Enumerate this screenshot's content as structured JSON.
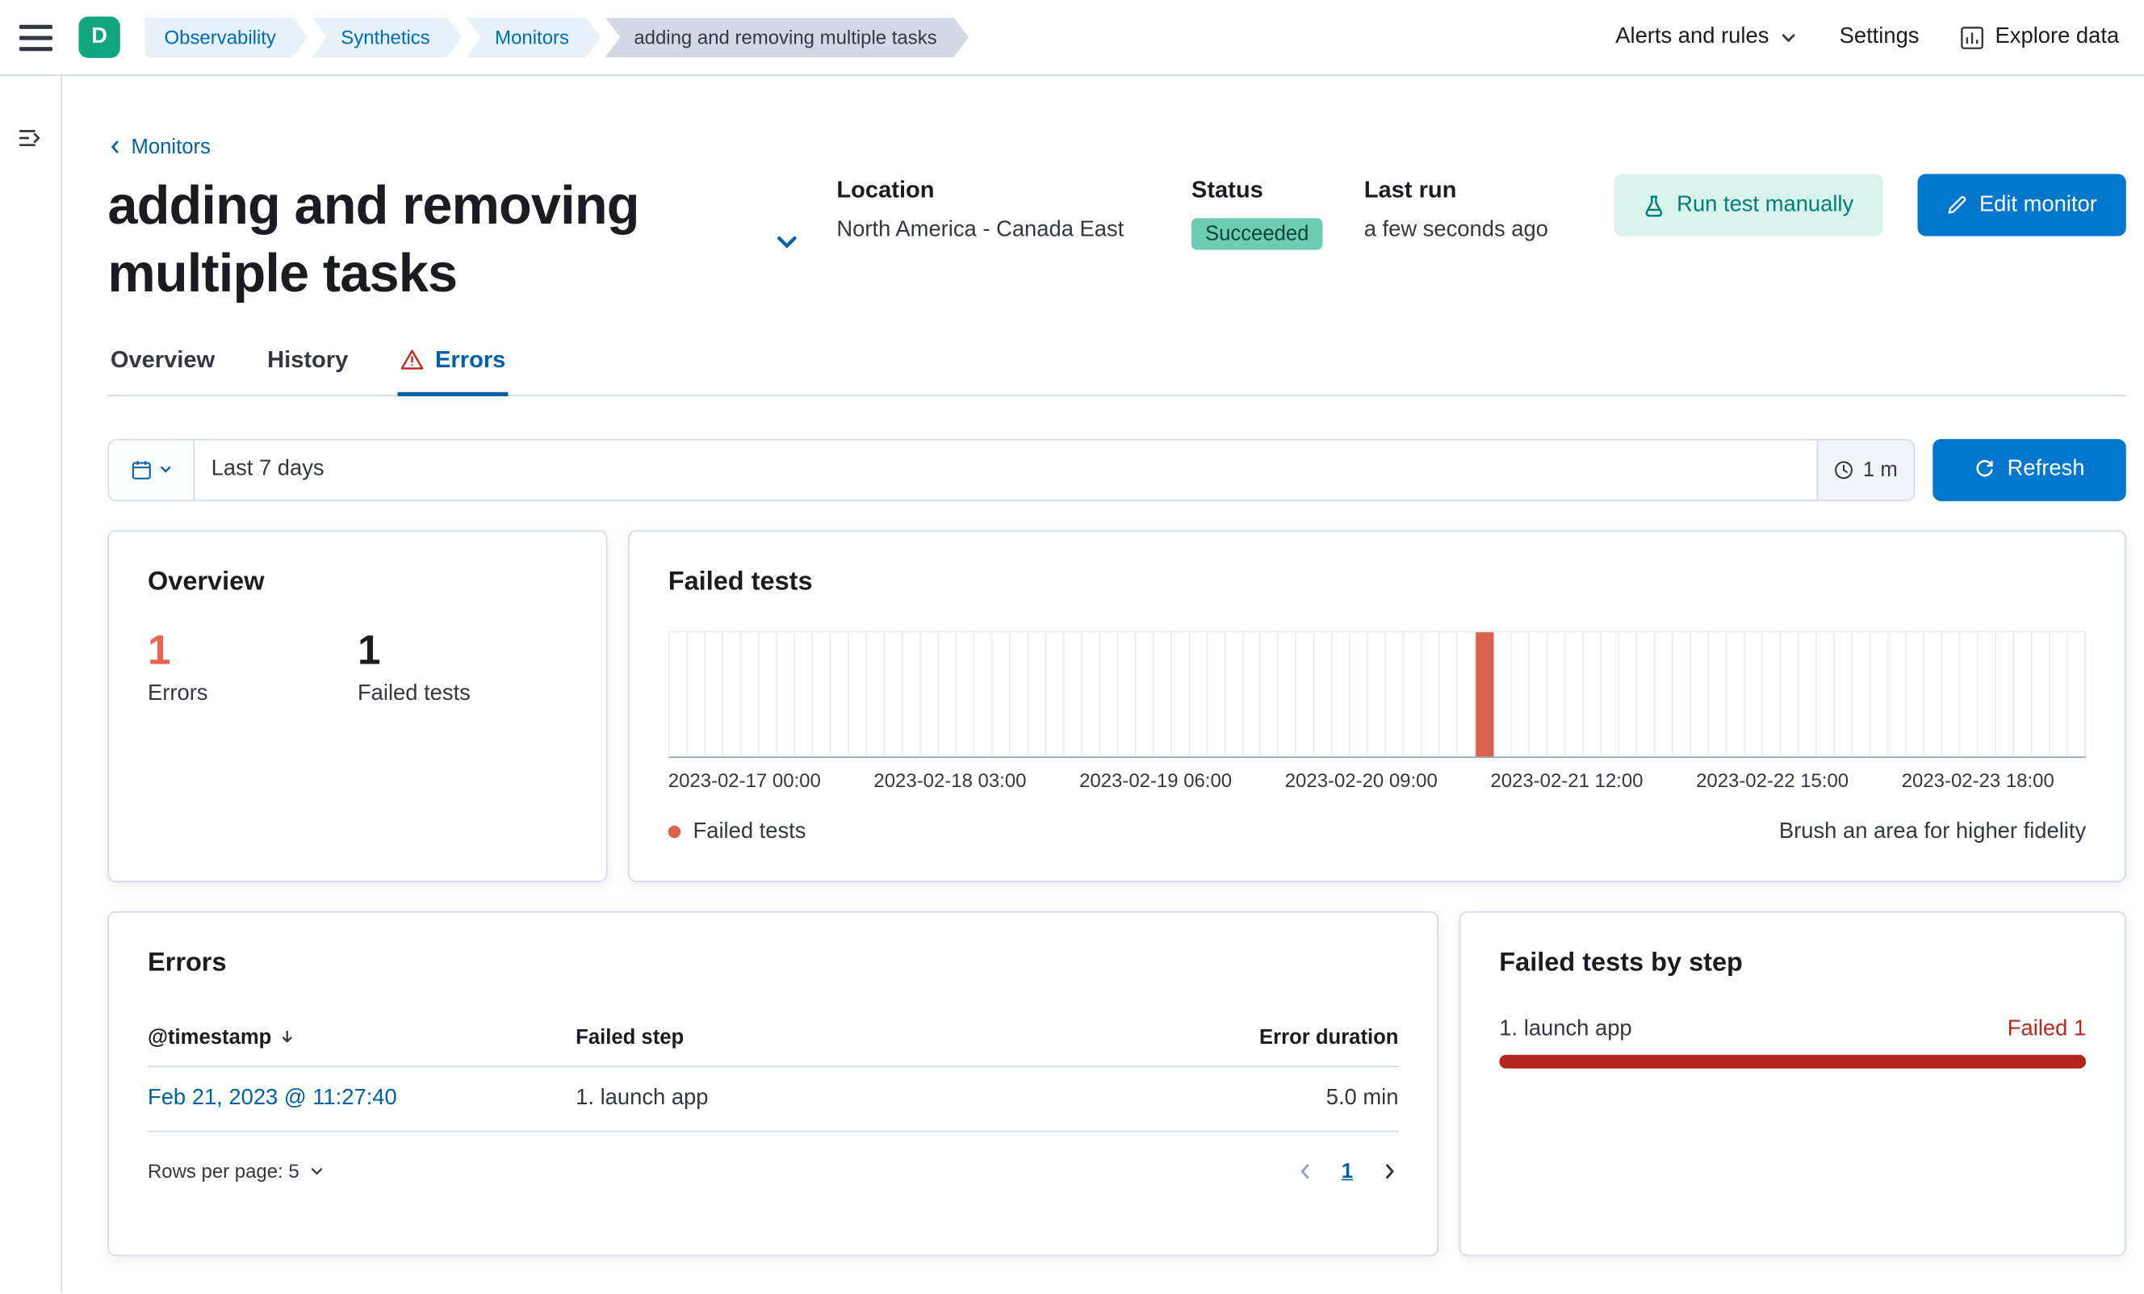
{
  "header": {
    "deployment_initial": "D",
    "breadcrumbs": [
      {
        "label": "Observability",
        "current": false
      },
      {
        "label": "Synthetics",
        "current": false
      },
      {
        "label": "Monitors",
        "current": false
      },
      {
        "label": "adding and removing multiple tasks",
        "current": true
      }
    ],
    "right": {
      "alerts_menu": "Alerts and rules",
      "settings": "Settings",
      "explore_data": "Explore data"
    }
  },
  "page": {
    "back_link": "Monitors",
    "title": "adding and removing multiple tasks",
    "meta": {
      "location_label": "Location",
      "location_value": "North America - Canada East",
      "status_label": "Status",
      "status_value": "Succeeded",
      "last_run_label": "Last run",
      "last_run_value": "a few seconds ago"
    },
    "actions": {
      "run_test": "Run test manually",
      "edit_monitor": "Edit monitor"
    },
    "tabs": [
      {
        "label": "Overview",
        "active": false
      },
      {
        "label": "History",
        "active": false
      },
      {
        "label": "Errors",
        "active": true
      }
    ]
  },
  "datepicker": {
    "range": "Last 7 days",
    "refresh_interval": "1 m",
    "refresh_label": "Refresh"
  },
  "overview_card": {
    "title": "Overview",
    "stats": [
      {
        "value": "1",
        "label": "Errors",
        "color": "#e7664c"
      },
      {
        "value": "1",
        "label": "Failed tests",
        "color": "#1a1c21"
      }
    ]
  },
  "failed_tests_card": {
    "title": "Failed tests",
    "legend": "Failed tests",
    "hint": "Brush an area for higher fidelity"
  },
  "chart_data": {
    "type": "bar",
    "title": "Failed tests",
    "x_ticks": [
      "2023-02-17 00:00",
      "2023-02-18 03:00",
      "2023-02-19 06:00",
      "2023-02-20 09:00",
      "2023-02-21 12:00",
      "2023-02-22 15:00",
      "2023-02-23 18:00"
    ],
    "x_range": [
      "2023-02-17 00:00",
      "2023-02-24 00:00"
    ],
    "ylim": [
      0,
      1
    ],
    "bins": 79,
    "grid": true,
    "legend": [
      "Failed tests"
    ],
    "legend_position": "bottom-left",
    "bar_color": "#d9604f",
    "series": [
      {
        "name": "Failed tests",
        "points": [
          {
            "x": "2023-02-21 01:00",
            "y": 1,
            "bin_index": 45
          }
        ]
      }
    ]
  },
  "errors_card": {
    "title": "Errors",
    "columns": [
      "@timestamp",
      "Failed step",
      "Error duration"
    ],
    "rows": [
      {
        "timestamp": "Feb 21, 2023 @ 11:27:40",
        "failed_step": "1. launch app",
        "error_duration": "5.0 min"
      }
    ],
    "rows_per_page": "Rows per page: 5",
    "page": "1"
  },
  "failed_steps_card": {
    "title": "Failed tests by step",
    "steps": [
      {
        "name": "1. launch app",
        "result": "Failed 1",
        "value": 1,
        "max": 1
      }
    ]
  },
  "colors": {
    "primary": "#0077cc",
    "link": "#0061a6",
    "success_badge_bg": "#6dccb1",
    "mint_button_bg": "#d8f3ec",
    "mint_button_text": "#007e77",
    "danger": "#bd271e",
    "failed_step_bar": "#b3261e",
    "chart_bar": "#d9604f",
    "error_stat": "#e7664c",
    "border": "#d3dae6"
  }
}
